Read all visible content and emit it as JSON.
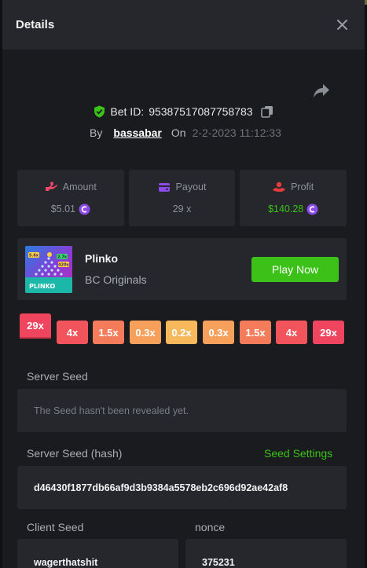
{
  "header": {
    "title": "Details"
  },
  "bet": {
    "id_label": "Bet ID:",
    "id": "95387517087758783",
    "by_label": "By",
    "username": "bassabar",
    "on_label": "On",
    "datetime": "2-2-2023 11:12:33"
  },
  "stats": {
    "amount": {
      "label": "Amount",
      "value": "$5.01"
    },
    "payout": {
      "label": "Payout",
      "value": "29 x"
    },
    "profit": {
      "label": "Profit",
      "value": "$140.28"
    }
  },
  "game": {
    "name": "Plinko",
    "provider": "BC Originals",
    "play_label": "Play Now",
    "thumb_text": "PLINKO",
    "thumb_badges": [
      "5.6x",
      "2.7x",
      "420x"
    ]
  },
  "multipliers": [
    {
      "label": "29x",
      "color": "#f0455f",
      "highlighted": true
    },
    {
      "label": "4x",
      "color": "#f2545b"
    },
    {
      "label": "1.5x",
      "color": "#f47c5a"
    },
    {
      "label": "0.3x",
      "color": "#f6a05c"
    },
    {
      "label": "0.2x",
      "color": "#f7b95c"
    },
    {
      "label": "0.3x",
      "color": "#f6a05c"
    },
    {
      "label": "1.5x",
      "color": "#f47c5a"
    },
    {
      "label": "4x",
      "color": "#f2545b"
    },
    {
      "label": "29x",
      "color": "#f0455f"
    }
  ],
  "seeds": {
    "server_seed_label": "Server Seed",
    "server_seed_value": "The Seed hasn't been revealed yet.",
    "server_hash_label": "Server Seed (hash)",
    "seed_settings_label": "Seed Settings",
    "server_hash_value": "d46430f1877db66af9d3b9384a5578eb2c696d92ae42af8",
    "client_seed_label": "Client Seed",
    "client_seed_value": "wagerthatshit",
    "nonce_label": "nonce",
    "nonce_value": "375231"
  },
  "colors": {
    "accent_green": "#3bc117",
    "amount_icon": "#e8486a",
    "payout_icon": "#8c4ae8",
    "profit_icon": "#e83c3c",
    "coin": "#8c4ae8"
  }
}
